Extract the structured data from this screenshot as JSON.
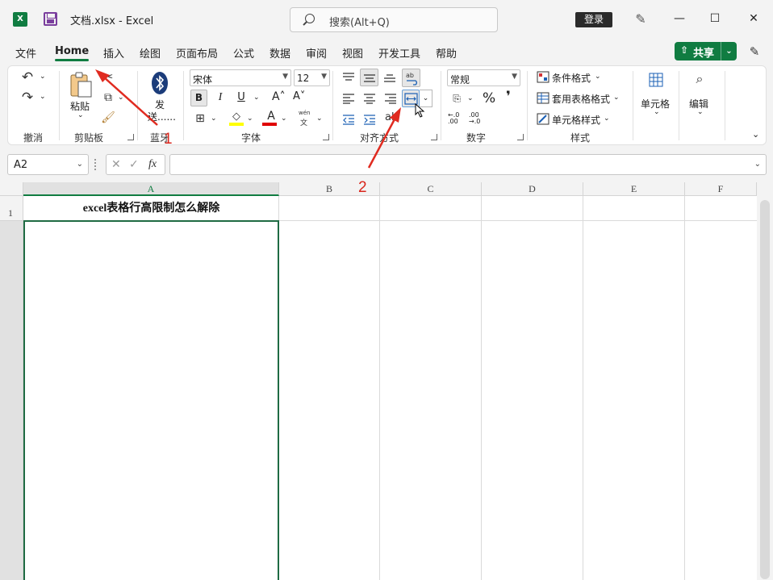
{
  "titlebar": {
    "app_icon_text": "X",
    "doc_title": "文档.xlsx  -  Excel",
    "search_placeholder": "搜索(Alt+Q)",
    "login_label": "登录",
    "minimize": "—",
    "maximize": "☐",
    "close": "✕"
  },
  "menu": {
    "tabs": [
      "文件",
      "Home",
      "插入",
      "绘图",
      "页面布局",
      "公式",
      "数据",
      "审阅",
      "视图",
      "开发工具",
      "帮助"
    ],
    "active": "Home",
    "share_label": "共享"
  },
  "ribbon": {
    "groups": {
      "undo": "撤消",
      "clipboard": "剪贴板",
      "bluetooth": "蓝牙",
      "font": "字体",
      "alignment": "对齐方式",
      "number": "数字",
      "styles": "样式"
    },
    "paste_label": "粘贴",
    "bluetooth_send_label_1": "发",
    "bluetooth_send_label_2": "送......",
    "font_name": "宋体",
    "font_size": "12",
    "bold": "B",
    "italic": "I",
    "underline": "U",
    "grow_font": "A˄",
    "shrink_font": "A˅",
    "font_color_letter": "A",
    "phonetic_top": "wén",
    "phonetic_bottom": "文",
    "number_format": "常规",
    "percent": "%",
    "comma": "❜",
    "increase_decimal": "←.0 .00",
    "decrease_decimal": ".00 →.0",
    "conditional_format": "条件格式",
    "format_as_table": "套用表格格式",
    "cell_styles": "单元格样式",
    "cells_label": "单元格",
    "editing_label": "编辑",
    "colors": {
      "highlight": "#ffff00",
      "font_color": "#e00000",
      "accent": "#107c41"
    }
  },
  "formula_bar": {
    "name_box": "A2",
    "cancel": "✕",
    "enter": "✓",
    "fx": "fx",
    "value": ""
  },
  "sheet": {
    "columns": [
      "A",
      "B",
      "C",
      "D",
      "E",
      "F"
    ],
    "selected_column": "A",
    "rows": [
      "1"
    ],
    "cell_a1": "excel表格行高限制怎么解除",
    "selected_cell": "A2"
  },
  "annotations": {
    "label_1": "1",
    "label_2": "2",
    "color": "#e02b20"
  }
}
